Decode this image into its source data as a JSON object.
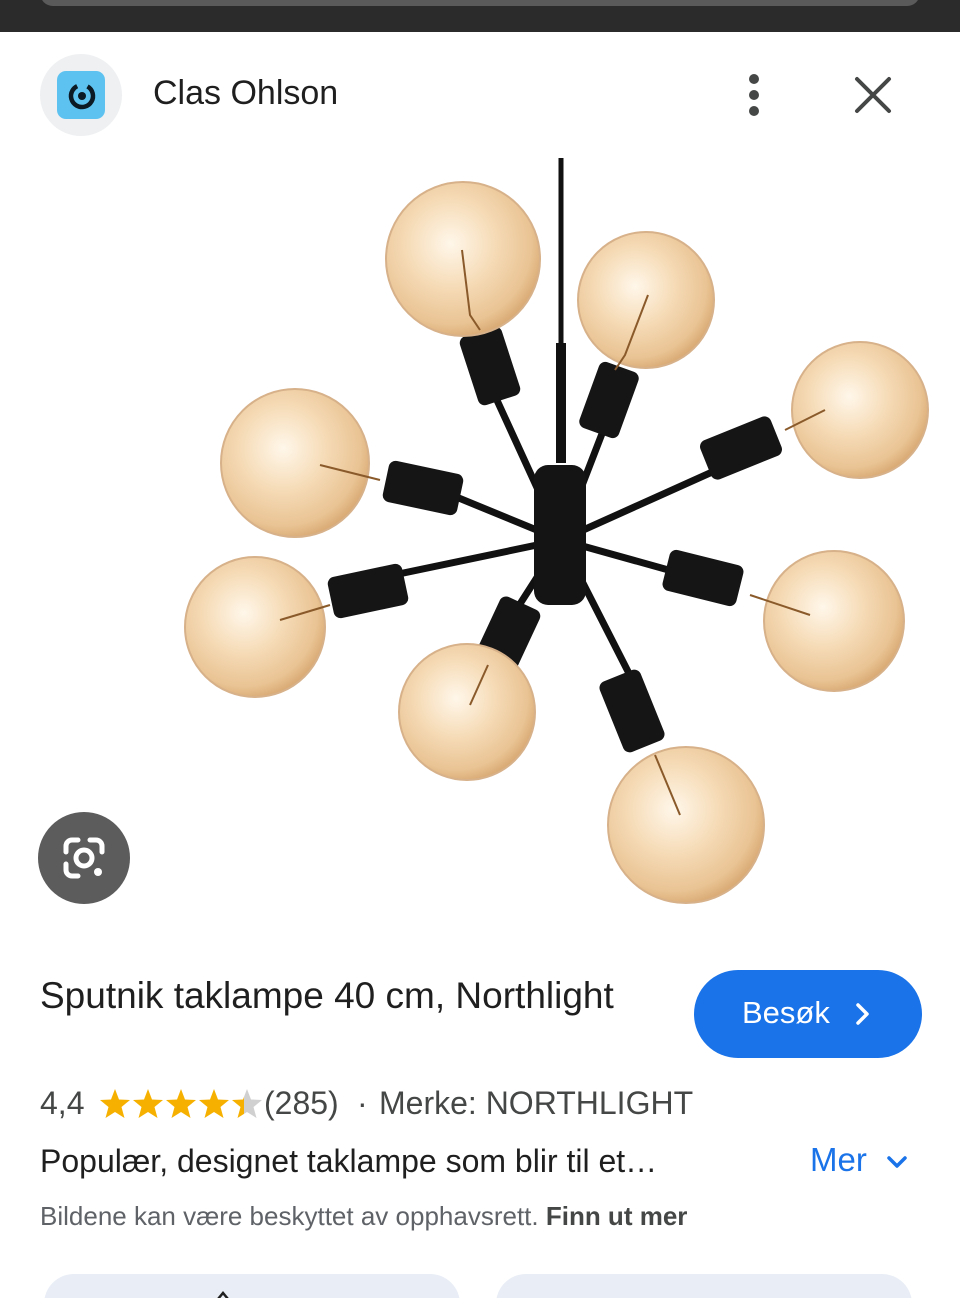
{
  "header": {
    "site_name": "Clas Ohlson",
    "logo_icon": "clas-ohlson-logo",
    "more_icon": "more-vert-icon",
    "close_icon": "close-icon"
  },
  "image": {
    "description_icon": "sputnik-pendant-lamp",
    "lens_icon": "google-lens-icon"
  },
  "product": {
    "title": "Sputnik taklampe 40 cm, Northlight",
    "rating": "4,4",
    "rating_stars": 4.4,
    "review_count": "(285)",
    "separator": "·",
    "brand": "Merke: NORTHLIGHT",
    "description": "Populær, designet taklampe som blir til et…",
    "more_label": "Mer"
  },
  "visit_button": {
    "label": "Besøk"
  },
  "copyright": {
    "text": "Bildene kan være beskyttet av opphavsrett.",
    "link": "Finn ut mer"
  },
  "colors": {
    "accent": "#1a73e8",
    "star": "#f6b100",
    "logo_bg": "#5ec2f0"
  }
}
